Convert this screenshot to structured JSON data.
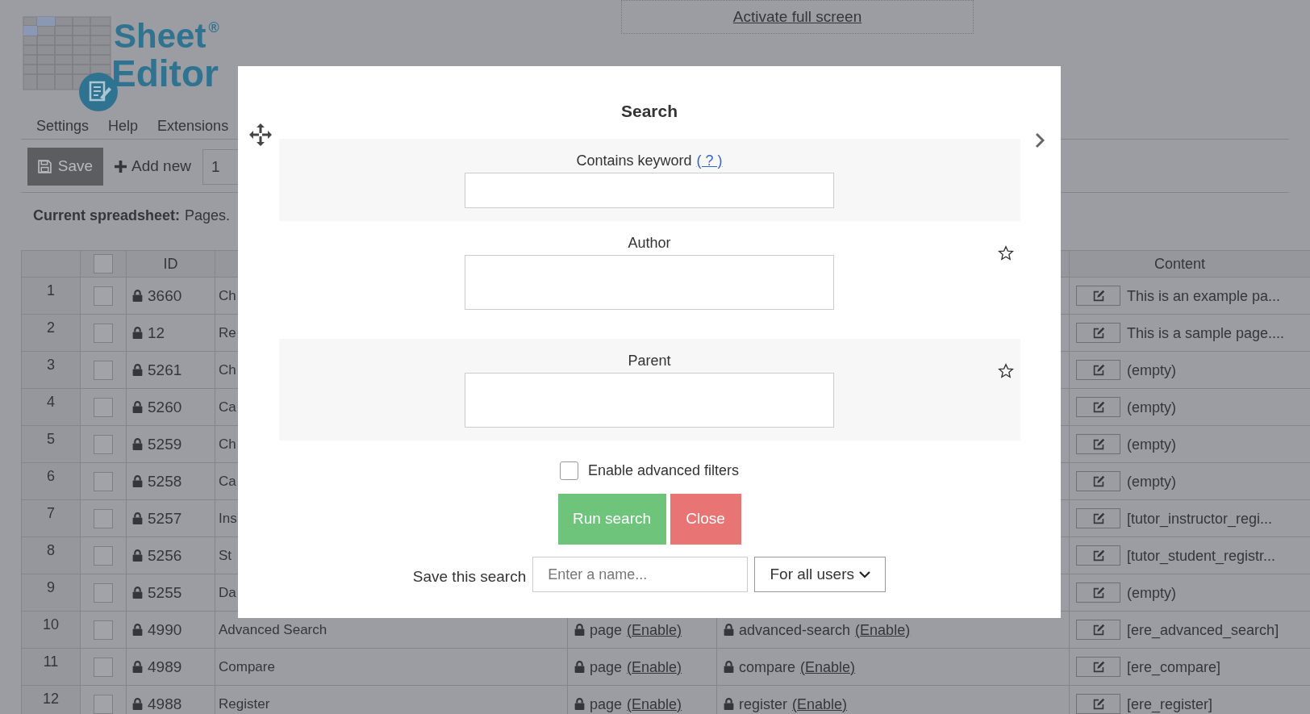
{
  "logo": {
    "word_1": "Sheet",
    "mark": "®",
    "word_2": "Editor"
  },
  "top_link": "Activate full screen",
  "menu": [
    "Settings",
    "Help",
    "Extensions"
  ],
  "toolbar": {
    "save": "Save",
    "add_new": "Add new",
    "page_input": "1"
  },
  "current": {
    "label": "Current spreadsheet:",
    "value": "Pages."
  },
  "table": {
    "header_checkbox": {
      "checked": false
    },
    "id_column": "ID",
    "content_column": "Content",
    "rows": [
      {
        "number": "1",
        "checked": false,
        "id": "3660",
        "title": "Ch",
        "content": "This is an example pa..."
      },
      {
        "number": "2",
        "checked": false,
        "id": "12",
        "title": "Re",
        "content": "This is a sample page...."
      },
      {
        "number": "3",
        "checked": false,
        "id": "5261",
        "title": "Ch",
        "content": "(empty)"
      },
      {
        "number": "4",
        "checked": false,
        "id": "5260",
        "title": "Ca",
        "content": "(empty)"
      },
      {
        "number": "5",
        "checked": false,
        "id": "5259",
        "title": "Ch",
        "content": "(empty)"
      },
      {
        "number": "6",
        "checked": false,
        "id": "5258",
        "title": "Ca",
        "content": "(empty)"
      },
      {
        "number": "7",
        "checked": false,
        "id": "5257",
        "title": "Ins",
        "content": "[tutor_instructor_regi..."
      },
      {
        "number": "8",
        "checked": false,
        "id": "5256",
        "title": "St",
        "content": "[tutor_student_registr..."
      },
      {
        "number": "9",
        "checked": false,
        "id": "5255",
        "title": "Da",
        "content": "(empty)"
      },
      {
        "number": "10",
        "checked": false,
        "id": "4990",
        "title": "Advanced Search",
        "type": {
          "text": "page",
          "link": "(Enable)"
        },
        "slug": {
          "text": "advanced-search",
          "link": "(Enable)"
        },
        "content": "[ere_advanced_search]"
      },
      {
        "number": "11",
        "checked": false,
        "id": "4989",
        "title": "Compare",
        "type": {
          "text": "page",
          "link": "(Enable)"
        },
        "slug": {
          "text": "compare",
          "link": "(Enable)"
        },
        "content": "[ere_compare]"
      },
      {
        "number": "12",
        "checked": false,
        "id": "4988",
        "title": "Register",
        "type": {
          "text": "page",
          "link": "(Enable)"
        },
        "slug": {
          "text": "register",
          "link": "(Enable)"
        },
        "content": "[ere_register]"
      }
    ]
  },
  "modal": {
    "title": "Search",
    "fields": [
      {
        "label": "Contains keyword",
        "help_link": "( ? )"
      },
      {
        "label": "Author",
        "starred": false
      },
      {
        "label": "Parent",
        "starred": false
      }
    ],
    "advanced": {
      "label": "Enable advanced filters",
      "checked": false
    },
    "buttons": [
      {
        "kind": "primary",
        "label": "Run search"
      },
      {
        "kind": "danger",
        "label": "Close"
      }
    ],
    "save": {
      "label": "Save this search",
      "placeholder": "Enter a name...",
      "scope": "For all users"
    }
  }
}
